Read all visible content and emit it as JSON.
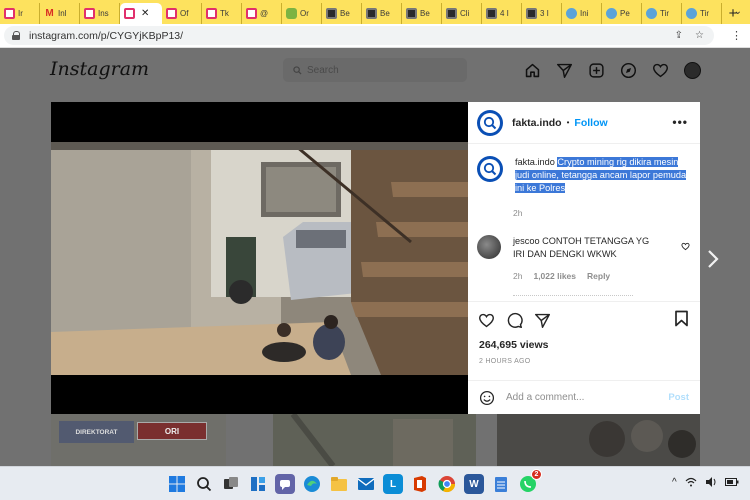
{
  "browser": {
    "tabs": [
      {
        "label": "Ir",
        "favicon": "generic-icon"
      },
      {
        "label": "Inl",
        "favicon": "gmail-icon"
      },
      {
        "label": "Ins",
        "favicon": "instagram-icon"
      },
      {
        "label": "",
        "favicon": "instagram-icon",
        "active": true
      },
      {
        "label": "Of",
        "favicon": "instagram-icon"
      },
      {
        "label": "Tk",
        "favicon": "instagram-icon"
      },
      {
        "label": "@",
        "favicon": "instagram-icon"
      },
      {
        "label": "Or",
        "favicon": "green-icon"
      },
      {
        "label": "Be",
        "favicon": "site-icon"
      },
      {
        "label": "Be",
        "favicon": "site-icon"
      },
      {
        "label": "Be",
        "favicon": "site-icon"
      },
      {
        "label": "Cli",
        "favicon": "site-icon"
      },
      {
        "label": "4 I",
        "favicon": "site-icon"
      },
      {
        "label": "3 I",
        "favicon": "site-icon"
      },
      {
        "label": "Ini",
        "favicon": "puzzle-icon"
      },
      {
        "label": "Pe",
        "favicon": "puzzle-icon"
      },
      {
        "label": "Tir",
        "favicon": "puzzle-icon"
      },
      {
        "label": "Tir",
        "favicon": "puzzle-icon"
      }
    ],
    "close_glyph": "✕",
    "new_tab_glyph": "+",
    "url": "instagram.com/p/CYGYjKBpP13/",
    "colors": {
      "tabbar": "#fde25e",
      "accent_link": "#0095f6"
    }
  },
  "instagram": {
    "logo": "Instagram",
    "search_placeholder": "Search",
    "nav_icons": [
      "home-icon",
      "direct-icon",
      "new-post-icon",
      "explore-icon",
      "activity-heart-icon",
      "profile-avatar"
    ]
  },
  "post": {
    "username": "fakta.indo",
    "separator": "•",
    "follow_label": "Follow",
    "more_label": "•••",
    "caption": {
      "username": "fakta.indo",
      "text": "Crypto mining rig dikira mesin judi online, tetangga ancam lapor pemuda ini ke Polres",
      "time": "2h"
    },
    "comments": [
      {
        "username": "jescoo",
        "text": "CONTOH TETANGGA YG IRI DAN DENGKI WKWK",
        "time": "2h",
        "likes": "1,022 likes",
        "reply_label": "Reply"
      }
    ],
    "views": "264,695 views",
    "posted_ago": "2 HOURS AGO",
    "add_comment_placeholder": "Add a comment...",
    "post_button": "Post"
  },
  "grid_thumbs": [
    {
      "sign_text": "DIREKTORAT",
      "label": "ORI"
    },
    {},
    {}
  ],
  "taskbar": {
    "icons": [
      "windows-start-icon",
      "search-icon",
      "task-view-icon",
      "widgets-icon",
      "teams-chat-icon",
      "edge-icon",
      "file-explorer-icon",
      "mail-icon",
      "lark-icon",
      "office-icon",
      "chrome-icon",
      "word-icon",
      "notepad-icon",
      "whatsapp-icon"
    ],
    "whatsapp_badge": "2",
    "tray_glyph": "^"
  }
}
